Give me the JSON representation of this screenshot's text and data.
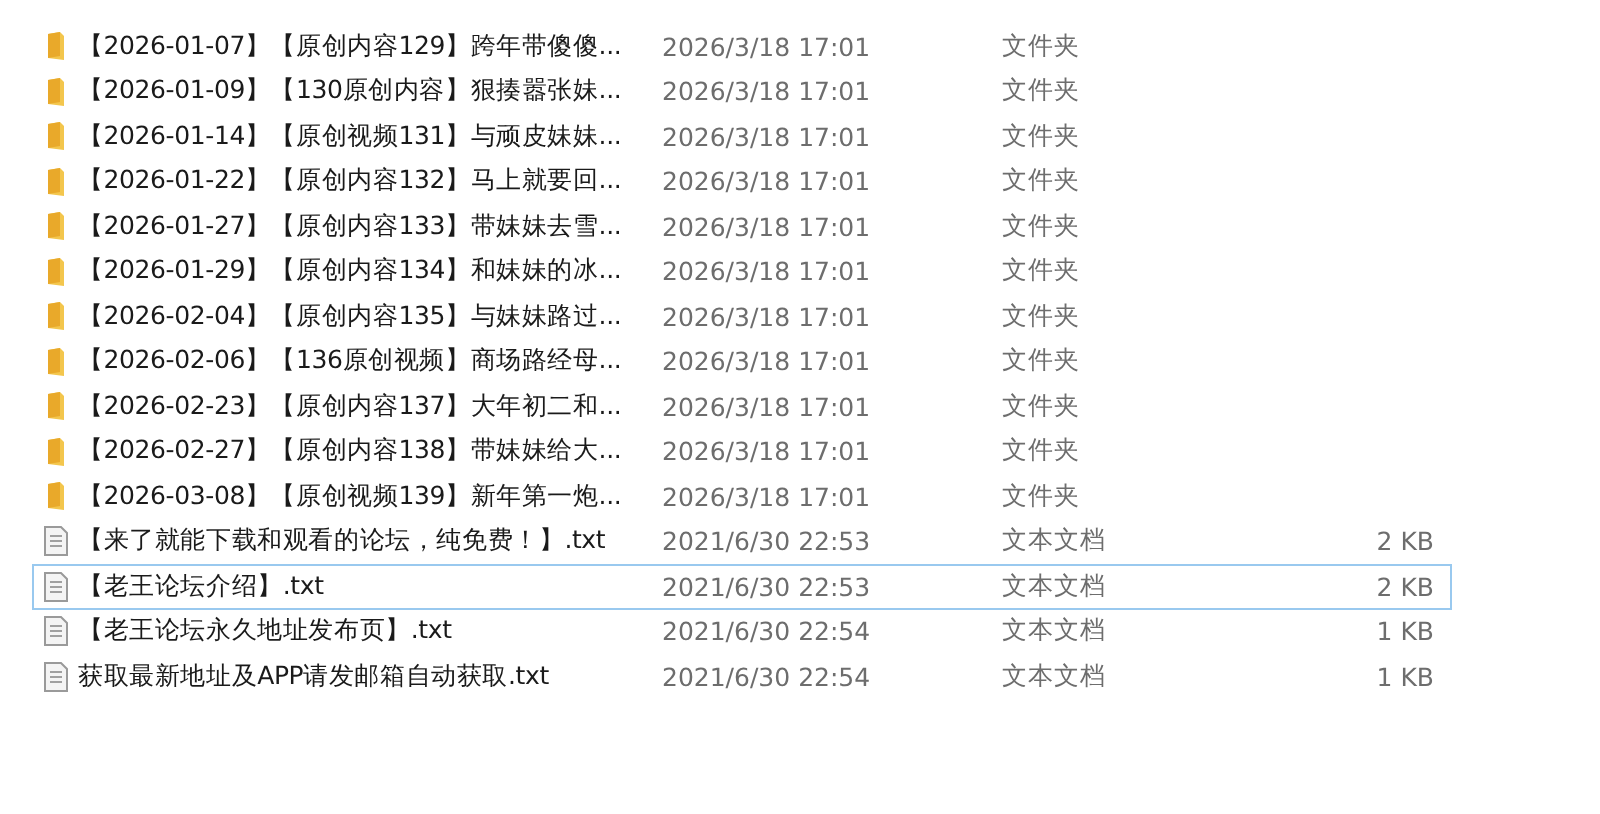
{
  "files": [
    {
      "kind": "folder",
      "name": "【2026-01-07】【原创内容129】跨年带傻傻...",
      "modified": "2026/3/18 17:01",
      "type": "文件夹",
      "focused": false
    },
    {
      "kind": "folder",
      "name": "【2026-01-09】【130原创内容】狠揍嚣张妹...",
      "modified": "2026/3/18 17:01",
      "type": "文件夹",
      "focused": false
    },
    {
      "kind": "folder",
      "name": "【2026-01-14】【原创视频131】与顽皮妹妹...",
      "modified": "2026/3/18 17:01",
      "type": "文件夹",
      "focused": false
    },
    {
      "kind": "folder",
      "name": "【2026-01-22】【原创内容132】马上就要回...",
      "modified": "2026/3/18 17:01",
      "type": "文件夹",
      "focused": false
    },
    {
      "kind": "folder",
      "name": "【2026-01-27】【原创内容133】带妹妹去雪...",
      "modified": "2026/3/18 17:01",
      "type": "文件夹",
      "focused": false
    },
    {
      "kind": "folder",
      "name": "【2026-01-29】【原创内容134】和妹妹的冰...",
      "modified": "2026/3/18 17:01",
      "type": "文件夹",
      "focused": false
    },
    {
      "kind": "folder",
      "name": "【2026-02-04】【原创内容135】与妹妹路过...",
      "modified": "2026/3/18 17:01",
      "type": "文件夹",
      "focused": false
    },
    {
      "kind": "folder",
      "name": "【2026-02-06】【136原创视频】商场路经母...",
      "modified": "2026/3/18 17:01",
      "type": "文件夹",
      "focused": false
    },
    {
      "kind": "folder",
      "name": "【2026-02-23】【原创内容137】大年初二和...",
      "modified": "2026/3/18 17:01",
      "type": "文件夹",
      "focused": false
    },
    {
      "kind": "folder",
      "name": "【2026-02-27】【原创内容138】带妹妹给大...",
      "modified": "2026/3/18 17:01",
      "type": "文件夹",
      "focused": false
    },
    {
      "kind": "folder",
      "name": "【2026-03-08】【原创视频139】新年第一炮...",
      "modified": "2026/3/18 17:01",
      "type": "文件夹",
      "focused": false
    },
    {
      "kind": "text-file",
      "name": "【来了就能下载和观看的论坛，纯免费！】.txt",
      "modified": "2021/6/30 22:53",
      "type": "文本文档",
      "size": "2 KB",
      "focused": false
    },
    {
      "kind": "text-file",
      "name": "【老王论坛介绍】.txt",
      "modified": "2021/6/30 22:53",
      "type": "文本文档",
      "size": "2 KB",
      "focused": true
    },
    {
      "kind": "text-file",
      "name": "【老王论坛永久地址发布页】.txt",
      "modified": "2021/6/30 22:54",
      "type": "文本文档",
      "size": "1 KB",
      "focused": false
    },
    {
      "kind": "text-file",
      "name": "获取最新地址及APP请发邮箱自动获取.txt",
      "modified": "2021/6/30 22:54",
      "type": "文本文档",
      "size": "1 KB",
      "focused": false
    }
  ]
}
